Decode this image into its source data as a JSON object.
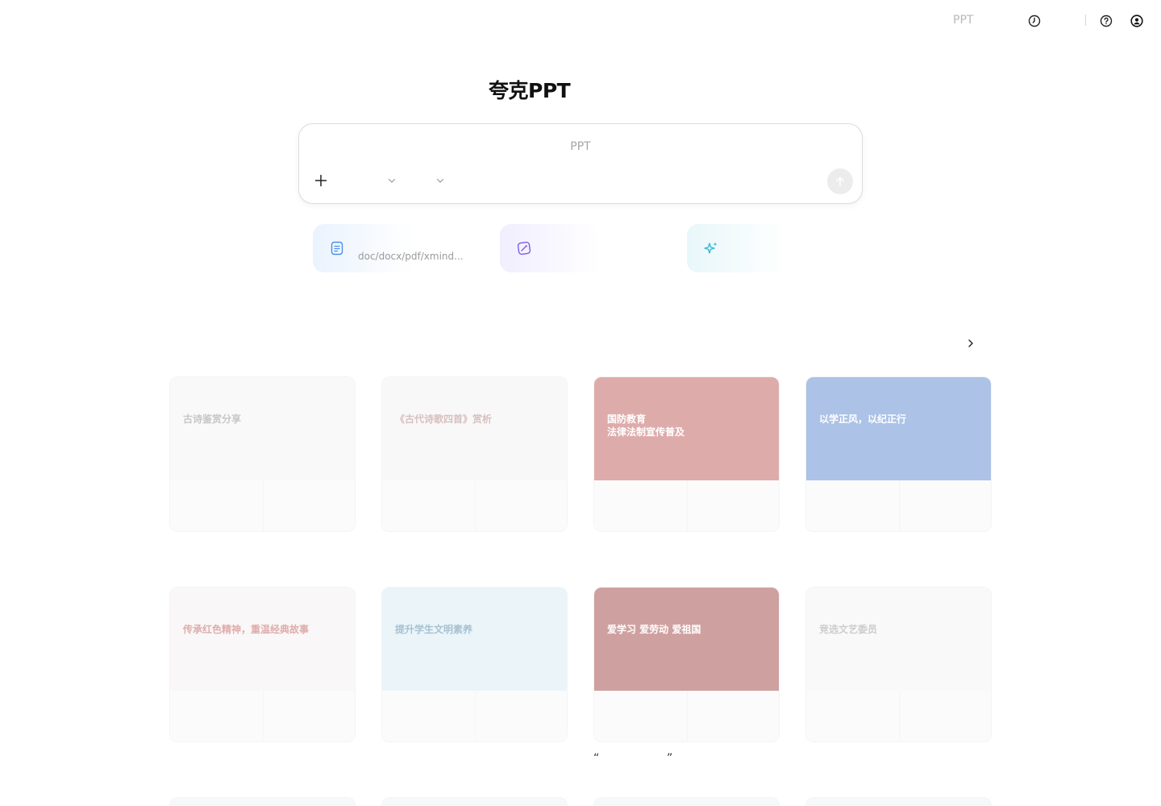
{
  "topbar": {
    "ppt_label": "PPT",
    "icons": [
      "history-icon",
      "help-icon",
      "user-icon"
    ]
  },
  "title": "夸克PPT",
  "prompt": {
    "placeholder": "PPT",
    "icons": [
      "plus-icon",
      "chevron-down-icon",
      "chevron-down-icon",
      "arrow-up-icon"
    ]
  },
  "features": [
    {
      "icon": "document-icon",
      "subtitle": "doc/docx/pdf/xmind...",
      "accent": "#4a8fe8"
    },
    {
      "icon": "edit-icon",
      "subtitle": "",
      "accent": "#7a5be8"
    },
    {
      "icon": "sparkle-icon",
      "subtitle": "",
      "accent": "#2fb6d3"
    }
  ],
  "templates": [
    {
      "title": "古诗鉴赏分享",
      "bg": "#f1f1f1",
      "text_color": "#7a7a7a"
    },
    {
      "title": "《古代诗歌四首》赏析",
      "bg": "#f3f0ef",
      "text_color": "#a06a6a"
    },
    {
      "title": "国防教育\n法律法制宣传普及",
      "bg": "#b33a3a",
      "text_color": "#ffffff"
    },
    {
      "title": "以学正风，以纪正行",
      "bg": "#3b6fc4",
      "text_color": "#ffffff"
    },
    {
      "title": "传承红色精神，重温经典故事",
      "bg": "#f3eeee",
      "text_color": "#b23b3b"
    },
    {
      "title": "提升学生文明素养",
      "bg": "#cfe6f3",
      "text_color": "#2f6d94"
    },
    {
      "title": "爱学习 爱劳动 爱祖国",
      "bg": "#8f1f1f",
      "text_color": "#ffffff"
    },
    {
      "title": "竞选文艺委员",
      "bg": "#f2f2f2",
      "text_color": "#888888"
    }
  ],
  "quote": {
    "open": "“",
    "close": "”"
  }
}
